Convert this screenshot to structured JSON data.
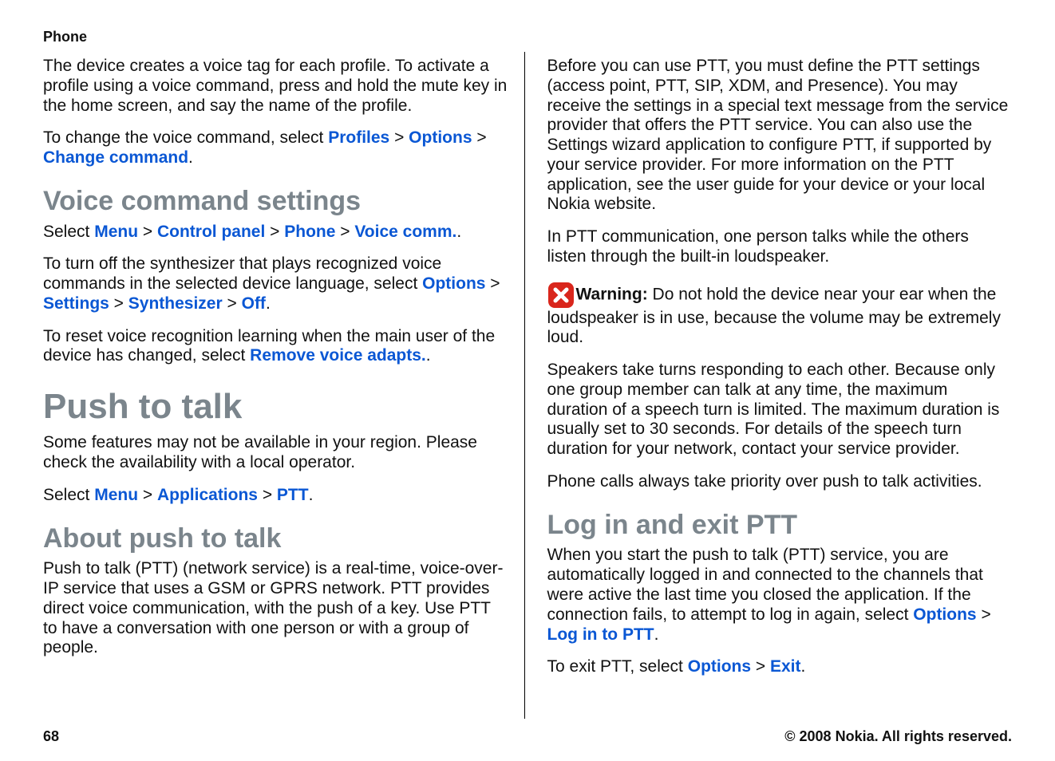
{
  "header": {
    "title": "Phone"
  },
  "left": {
    "p1": "The device creates a voice tag for each profile. To activate a profile using a voice command, press and hold the mute key in the home screen, and say the name of the profile.",
    "p2_pre": "To change the voice command, select ",
    "p2_profiles": "Profiles",
    "p2_options": "Options",
    "p2_change": "Change command",
    "sep_gt": " > ",
    "period": ".",
    "h_voice_cmd": "Voice command settings",
    "p3_pre": "Select ",
    "p3_menu": "Menu",
    "p3_cp": "Control panel",
    "p3_phone": "Phone",
    "p3_voice": "Voice comm.",
    "p4_pre": "To turn off the synthesizer that plays recognized voice commands in the selected device language, select ",
    "p4_options": "Options",
    "p4_settings": "Settings",
    "p4_synth": "Synthesizer",
    "p4_off": "Off",
    "p5_pre": "To reset voice recognition learning when the main user of the device has changed, select ",
    "p5_remove": "Remove voice adapts.",
    "h_ptt": "Push to talk",
    "p6": "Some features may not be available in your region. Please check the availability with a local operator.",
    "p7_pre": "Select ",
    "p7_menu": "Menu",
    "p7_apps": "Applications",
    "p7_ptt": "PTT",
    "h_about": "About push to talk",
    "p8": "Push to talk (PTT) (network service) is a real-time, voice-over-IP service that uses a GSM or GPRS network. PTT provides direct voice communication, with the push of a key. Use PTT to have a conversation with one person or with a group of people."
  },
  "right": {
    "p1": "Before you can use PTT, you must define the PTT settings (access point, PTT, SIP, XDM, and Presence). You may receive the settings in a special text message from the service provider that offers the PTT service. You can also use the Settings wizard application to configure PTT, if supported by your service provider. For more information on the PTT application, see the user guide for your device or your local Nokia website.",
    "p2": "In PTT communication, one person talks while the others listen through the built-in loudspeaker.",
    "warn_label": "Warning:  ",
    "warn_text": "Do not hold the device near your ear when the loudspeaker is in use, because the volume may be extremely loud.",
    "p3": "Speakers take turns responding to each other. Because only one group member can talk at any time, the maximum duration of a speech turn is limited. The maximum duration is usually set to 30 seconds. For details of the speech turn duration for your network, contact your service provider.",
    "p4": "Phone calls always take priority over push to talk activities.",
    "h_login": "Log in and exit PTT",
    "p5_pre": "When you start the push to talk (PTT) service, you are automatically logged in and connected to the channels that were active the last time you closed the application. If the connection fails, to attempt to log in again, select ",
    "p5_options": "Options",
    "p5_login": "Log in to PTT",
    "p6_pre": "To exit PTT, select ",
    "p6_options": "Options",
    "p6_exit": "Exit"
  },
  "footer": {
    "page": "68",
    "copyright": "© 2008 Nokia. All rights reserved."
  }
}
